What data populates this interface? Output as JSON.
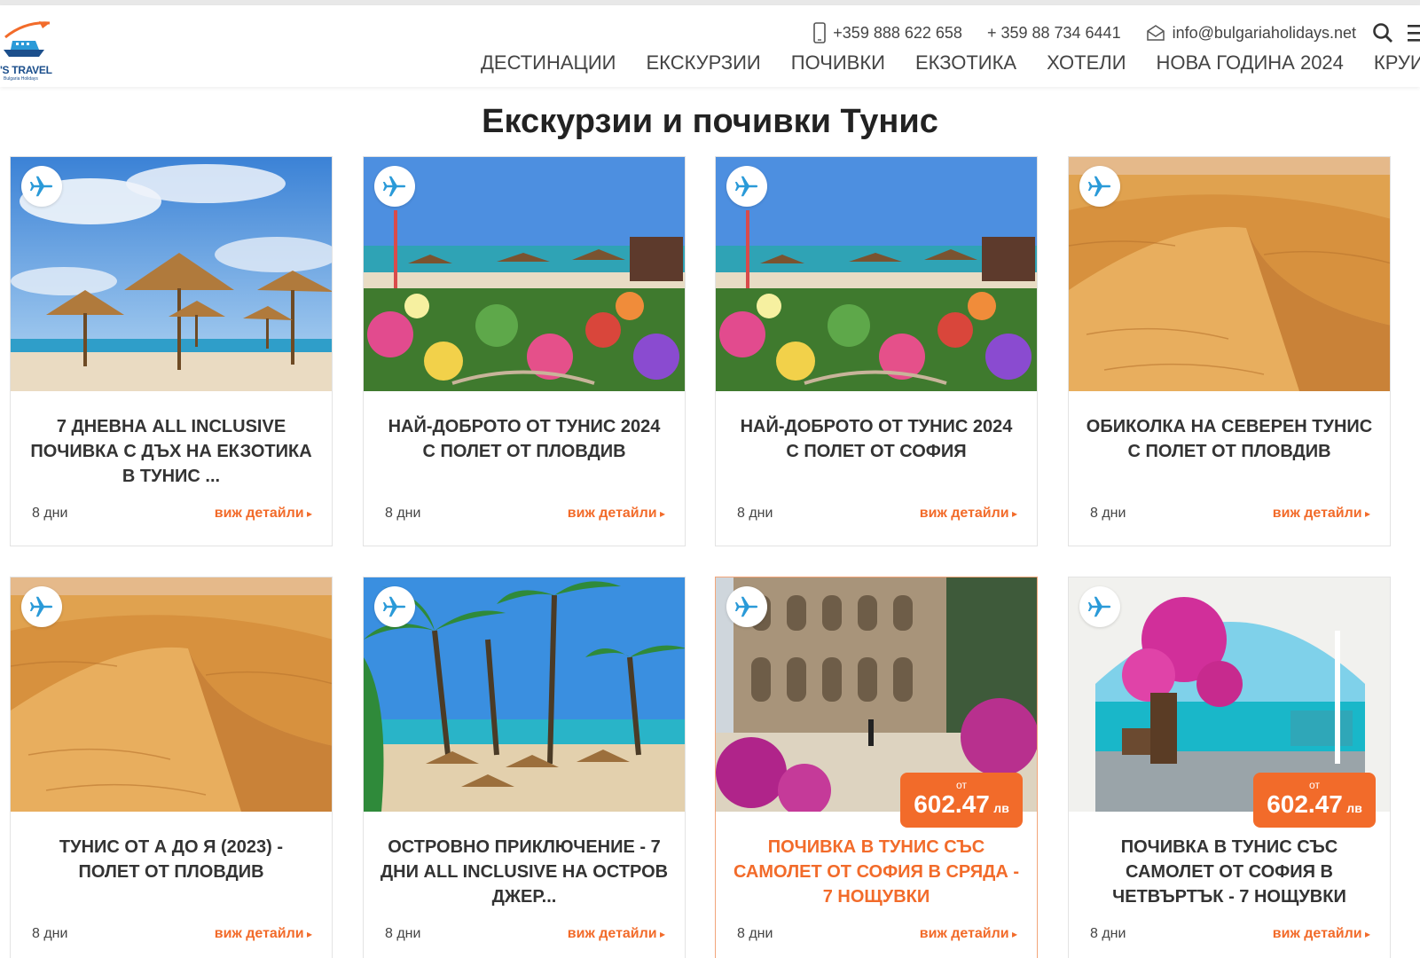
{
  "header": {
    "logo_text": "'S TRAVEL",
    "logo_sub": "Bulgaria Holidays",
    "phone1": "+359 888 622 658",
    "phone2": "+ 359 88 734 6441",
    "email": "info@bulgariaholidays.net"
  },
  "nav": {
    "items": [
      "ДЕСТИНАЦИИ",
      "ЕКСКУРЗИИ",
      "ПОЧИВКИ",
      "ЕКЗОТИКА",
      "ХОТЕЛИ",
      "НОВА ГОДИНА 2024",
      "КРУИЗ"
    ]
  },
  "page": {
    "title": "Екскурзии и почивки Тунис"
  },
  "cards": [
    {
      "title": "7 ДНЕВНА ALL INCLUSIVE ПОЧИВКА С ДЪХ НА ЕКЗОТИКА В ТУНИС ...",
      "days": "8 дни",
      "link": "виж детайли",
      "image": "beach-umbrellas"
    },
    {
      "title": "НАЙ-ДОБРОТО ОТ ТУНИС 2024 С ПОЛЕТ ОТ ПЛОВДИВ",
      "days": "8 дни",
      "link": "виж детайли",
      "image": "garden-beach"
    },
    {
      "title": "НАЙ-ДОБРОТО ОТ ТУНИС 2024 С ПОЛЕТ ОТ СОФИЯ",
      "days": "8 дни",
      "link": "виж детайли",
      "image": "garden-beach"
    },
    {
      "title": "ОБИКОЛКА НА СЕВЕРЕН ТУНИС С ПОЛЕТ ОТ ПЛОВДИВ",
      "days": "8 дни",
      "link": "виж детайли",
      "image": "desert-dunes"
    },
    {
      "title": "ТУНИС ОТ А ДО Я (2023) - ПОЛЕТ ОТ ПЛОВДИВ",
      "days": "8 дни",
      "link": "виж детайли",
      "image": "desert-dunes"
    },
    {
      "title": "ОСТРОВНО ПРИКЛЮЧЕНИЕ - 7 ДНИ ALL INCLUSIVE НА ОСТРОВ ДЖЕР...",
      "days": "8 дни",
      "link": "виж детайли",
      "image": "palm-beach"
    },
    {
      "title": "ПОЧИВКА В ТУНИС СЪС САМОЛЕТ ОТ СОФИЯ В СРЯДА - 7 НОЩУВКИ",
      "days": "8 дни",
      "link": "виж детайли",
      "image": "colosseum",
      "price_from": "от",
      "price": "602.47",
      "currency": "лв",
      "highlight": true
    },
    {
      "title": "ПОЧИВКА В ТУНИС СЪС САМОЛЕТ ОТ СОФИЯ В ЧЕТВЪРТЪК - 7 НОЩУВКИ",
      "days": "8 дни",
      "link": "виж детайли",
      "image": "sea-arch",
      "price_from": "от",
      "price": "602.47",
      "currency": "лв"
    }
  ],
  "colors": {
    "accent": "#f26b2a",
    "plane_icon": "#2a9ad8",
    "logo_blue": "#1c4f8c"
  }
}
